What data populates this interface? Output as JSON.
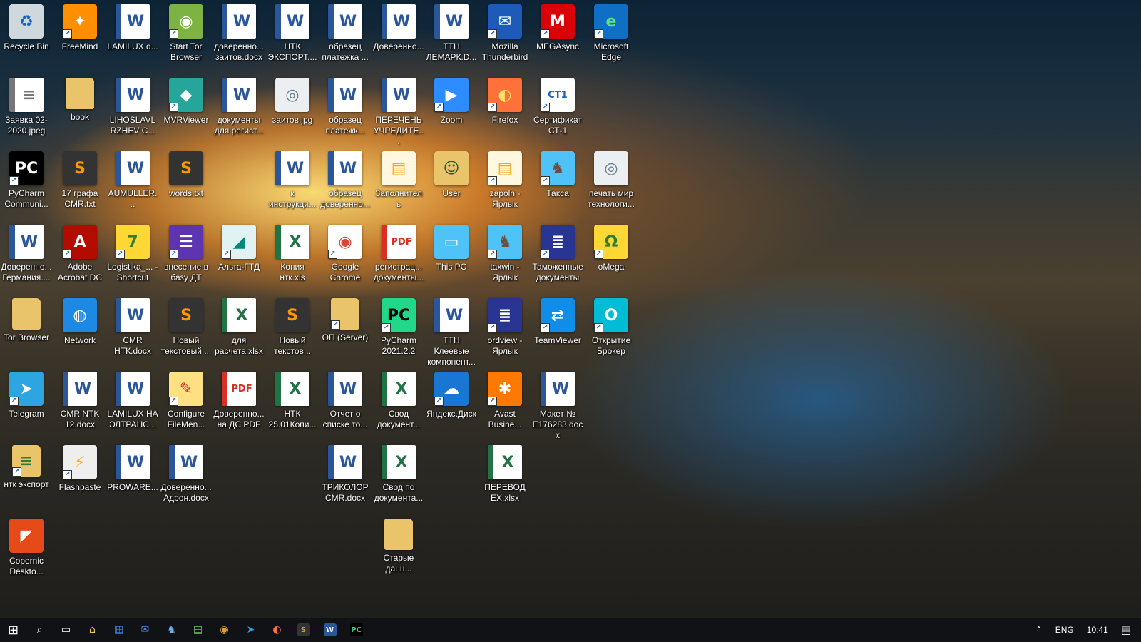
{
  "desktop": {
    "icons": [
      {
        "id": "recycle-bin",
        "label": "Recycle Bin",
        "type": "recycle",
        "col": 0,
        "row": 0,
        "shortcut": false
      },
      {
        "id": "freemind",
        "label": "FreeMind",
        "type": "butterfly",
        "col": 1,
        "row": 0,
        "shortcut": true
      },
      {
        "id": "lamilux-d",
        "label": "LAMILUX.d...",
        "type": "word",
        "col": 2,
        "row": 0,
        "shortcut": false
      },
      {
        "id": "start-tor-browser",
        "label": "Start Tor Browser",
        "type": "tor",
        "col": 3,
        "row": 0,
        "shortcut": true
      },
      {
        "id": "doverennosti-zaitov",
        "label": "доверенно... заитов.docx",
        "type": "word",
        "col": 4,
        "row": 0,
        "shortcut": false
      },
      {
        "id": "ntk-eksport",
        "label": "НТК ЭКСПОРТ....",
        "type": "word",
        "col": 5,
        "row": 0,
        "shortcut": false
      },
      {
        "id": "obrazets-platezhka",
        "label": "образец платежка ...",
        "type": "word",
        "col": 6,
        "row": 0,
        "shortcut": false
      },
      {
        "id": "doverenno-1",
        "label": "Доверенно...",
        "type": "word",
        "col": 7,
        "row": 0,
        "shortcut": false
      },
      {
        "id": "ttn-lemark",
        "label": "ТТН ЛЕМАРК.D...",
        "type": "word",
        "col": 8,
        "row": 0,
        "shortcut": false
      },
      {
        "id": "mozilla-thunderbird",
        "label": "Mozilla Thunderbird",
        "type": "thunderbird",
        "col": 9,
        "row": 0,
        "shortcut": true
      },
      {
        "id": "megasync",
        "label": "MEGAsync",
        "type": "mega",
        "col": 10,
        "row": 0,
        "shortcut": true
      },
      {
        "id": "microsoft-edge",
        "label": "Microsoft Edge",
        "type": "edge",
        "col": 11,
        "row": 0,
        "shortcut": true
      },
      {
        "id": "zayavka",
        "label": "Заявка 02-2020.jpeg",
        "type": "doc",
        "col": 0,
        "row": 1,
        "shortcut": false
      },
      {
        "id": "book",
        "label": "book",
        "type": "folder",
        "col": 1,
        "row": 1,
        "shortcut": false
      },
      {
        "id": "lihoslavl",
        "label": "LIHOSLAVL RZHEV C...",
        "type": "word",
        "col": 2,
        "row": 1,
        "shortcut": false
      },
      {
        "id": "mvrviewer",
        "label": "MVRViewer",
        "type": "mvr",
        "col": 3,
        "row": 1,
        "shortcut": true
      },
      {
        "id": "dokumenty-registr",
        "label": "документы для регист...",
        "type": "word",
        "col": 4,
        "row": 1,
        "shortcut": false
      },
      {
        "id": "zaitov-jpg",
        "label": "заитов.jpg",
        "type": "stamp",
        "col": 5,
        "row": 1,
        "shortcut": false
      },
      {
        "id": "obrazets-platezh",
        "label": "образец платежк...",
        "type": "word",
        "col": 6,
        "row": 1,
        "shortcut": false
      },
      {
        "id": "perechen",
        "label": "ПЕРЕЧЕНЬ УЧРЕДИТЕ...",
        "type": "word",
        "col": 7,
        "row": 1,
        "shortcut": false
      },
      {
        "id": "zoom",
        "label": "Zoom",
        "type": "zoom",
        "col": 8,
        "row": 1,
        "shortcut": true
      },
      {
        "id": "firefox",
        "label": "Firefox",
        "type": "firefox",
        "col": 9,
        "row": 1,
        "shortcut": true
      },
      {
        "id": "sertifikat",
        "label": "Сертификат СТ-1",
        "type": "ct1",
        "col": 10,
        "row": 1,
        "shortcut": true
      },
      {
        "id": "pycharm-community",
        "label": "PyCharm Communi...",
        "type": "pycharm",
        "col": 0,
        "row": 2,
        "shortcut": true
      },
      {
        "id": "17-grafa",
        "label": "17 графа CMR.txt",
        "type": "sublime",
        "col": 1,
        "row": 2,
        "shortcut": false
      },
      {
        "id": "aumuller",
        "label": "AUMULLER...",
        "type": "word",
        "col": 2,
        "row": 2,
        "shortcut": false
      },
      {
        "id": "words-txt",
        "label": "words.txt",
        "type": "sublime",
        "col": 3,
        "row": 2,
        "shortcut": false
      },
      {
        "id": "k-instruktsii",
        "label": "к инструкци...",
        "type": "word",
        "col": 5,
        "row": 2,
        "shortcut": false
      },
      {
        "id": "obrazets-doverennost",
        "label": "образец доверенно...",
        "type": "word",
        "col": 6,
        "row": 2,
        "shortcut": false
      },
      {
        "id": "zapolnitel",
        "label": "Заполнитель",
        "type": "zapoln",
        "col": 7,
        "row": 2,
        "shortcut": false
      },
      {
        "id": "user",
        "label": "User",
        "type": "userfolder",
        "col": 8,
        "row": 2,
        "shortcut": false
      },
      {
        "id": "zapoln-yarlyk",
        "label": "zapoln - Ярлык",
        "type": "zapoln",
        "col": 9,
        "row": 2,
        "shortcut": true
      },
      {
        "id": "taksa",
        "label": "Такса",
        "type": "dog",
        "col": 10,
        "row": 2,
        "shortcut": true
      },
      {
        "id": "pechat-mir",
        "label": "печать мир технологи...",
        "type": "stamp",
        "col": 11,
        "row": 2,
        "shortcut": false
      },
      {
        "id": "doverenno-germaniya",
        "label": "Доверенно... Германия....",
        "type": "word",
        "col": 0,
        "row": 3,
        "shortcut": false
      },
      {
        "id": "adobe-acrobat",
        "label": "Adobe Acrobat DC",
        "type": "acrobat",
        "col": 1,
        "row": 3,
        "shortcut": true
      },
      {
        "id": "logistika",
        "label": "Logistika_... - Shortcut",
        "type": "logistika",
        "col": 2,
        "row": 3,
        "shortcut": true
      },
      {
        "id": "vnesenie-v-bazu",
        "label": "внесение в базу ДТ",
        "type": "list",
        "col": 3,
        "row": 3,
        "shortcut": true
      },
      {
        "id": "alta-gtd",
        "label": "Альта-ГТД",
        "type": "alta",
        "col": 4,
        "row": 3,
        "shortcut": true
      },
      {
        "id": "kopiya-ntk",
        "label": "Копия нтк.xls",
        "type": "excel",
        "col": 5,
        "row": 3,
        "shortcut": false
      },
      {
        "id": "google-chrome",
        "label": "Google Chrome",
        "type": "chrome",
        "col": 6,
        "row": 3,
        "shortcut": true
      },
      {
        "id": "registratsiya-dokumenty",
        "label": "регистрац... документы...",
        "type": "pdf",
        "col": 7,
        "row": 3,
        "shortcut": false
      },
      {
        "id": "this-pc",
        "label": "This PC",
        "type": "pc",
        "col": 8,
        "row": 3,
        "shortcut": false
      },
      {
        "id": "taxwin",
        "label": "taxwin - Ярлык",
        "type": "dog",
        "col": 9,
        "row": 3,
        "shortcut": true
      },
      {
        "id": "tamozhennye",
        "label": "Таможенные документы",
        "type": "books",
        "col": 10,
        "row": 3,
        "shortcut": true
      },
      {
        "id": "omega",
        "label": "oMega",
        "type": "omega",
        "col": 11,
        "row": 3,
        "shortcut": true
      },
      {
        "id": "tor-browser",
        "label": "Tor Browser",
        "type": "folder",
        "col": 0,
        "row": 4,
        "shortcut": false
      },
      {
        "id": "network",
        "label": "Network",
        "type": "network",
        "col": 1,
        "row": 4,
        "shortcut": false
      },
      {
        "id": "cmr-ntk",
        "label": "CMR НТК.docx",
        "type": "word",
        "col": 2,
        "row": 4,
        "shortcut": false
      },
      {
        "id": "novyi-tekstovyi-1",
        "label": "Новый текстовый ...",
        "type": "sublime",
        "col": 3,
        "row": 4,
        "shortcut": false
      },
      {
        "id": "dlya-rascheta",
        "label": "для расчета.xlsx",
        "type": "excel",
        "col": 4,
        "row": 4,
        "shortcut": false
      },
      {
        "id": "novyi-tekstov-2",
        "label": "Новый текстов...",
        "type": "sublime",
        "col": 5,
        "row": 4,
        "shortcut": false
      },
      {
        "id": "op-server",
        "label": "ОП (Server)",
        "type": "folder",
        "col": 6,
        "row": 4,
        "shortcut": true
      },
      {
        "id": "pycharm-2021",
        "label": "PyCharm 2021.2.2",
        "type": "pycharm2",
        "col": 7,
        "row": 4,
        "shortcut": true
      },
      {
        "id": "ttn-kleevye",
        "label": "ТТН Клеевые компонент...",
        "type": "word",
        "col": 8,
        "row": 4,
        "shortcut": false
      },
      {
        "id": "ordview",
        "label": "ordview - Ярлык",
        "type": "books",
        "col": 9,
        "row": 4,
        "shortcut": true
      },
      {
        "id": "teamviewer",
        "label": "TeamViewer",
        "type": "teamviewer",
        "col": 10,
        "row": 4,
        "shortcut": true
      },
      {
        "id": "otkrytie-broker",
        "label": "Открытие Брокер",
        "type": "otkrytie",
        "col": 11,
        "row": 4,
        "shortcut": true
      },
      {
        "id": "telegram",
        "label": "Telegram",
        "type": "telegram",
        "col": 0,
        "row": 5,
        "shortcut": true
      },
      {
        "id": "cmr-ntk-12",
        "label": "CMR NTK 12.docx",
        "type": "word",
        "col": 1,
        "row": 5,
        "shortcut": false
      },
      {
        "id": "lamilux-na",
        "label": "LAMILUX НА ЭЛТРАНС...",
        "type": "word",
        "col": 2,
        "row": 5,
        "shortcut": false
      },
      {
        "id": "configure-filemen",
        "label": "Configure FileMen...",
        "type": "configure",
        "col": 3,
        "row": 5,
        "shortcut": true
      },
      {
        "id": "doverenno-ds-pdf",
        "label": "Доверенно... на ДС.PDF",
        "type": "pdf",
        "col": 4,
        "row": 5,
        "shortcut": false
      },
      {
        "id": "ntk-25-01",
        "label": "НТК 25.01Копи...",
        "type": "excel",
        "col": 5,
        "row": 5,
        "shortcut": false
      },
      {
        "id": "otchet-o-spiske",
        "label": "Отчет о списке то...",
        "type": "word",
        "col": 6,
        "row": 5,
        "shortcut": false
      },
      {
        "id": "svod-dokument",
        "label": "Свод документ...",
        "type": "excel",
        "col": 7,
        "row": 5,
        "shortcut": false
      },
      {
        "id": "yandex-disk",
        "label": "Яндекс.Диск",
        "type": "yandex",
        "col": 8,
        "row": 5,
        "shortcut": true
      },
      {
        "id": "avast",
        "label": "Avast Busine...",
        "type": "avast",
        "col": 9,
        "row": 5,
        "shortcut": true
      },
      {
        "id": "maket",
        "label": "Макет № E176283.docx",
        "type": "word",
        "col": 10,
        "row": 5,
        "shortcut": false
      },
      {
        "id": "ntk-eksport-2",
        "label": "нтк экспорт",
        "type": "folder2",
        "col": 0,
        "row": 6,
        "shortcut": true
      },
      {
        "id": "flashpaste",
        "label": "Flashpaste",
        "type": "flashpaste",
        "col": 1,
        "row": 6,
        "shortcut": true
      },
      {
        "id": "proware",
        "label": "PROWARE...",
        "type": "word",
        "col": 2,
        "row": 6,
        "shortcut": false
      },
      {
        "id": "doverenno-adron",
        "label": "Доверенно... Адрон.docx",
        "type": "word",
        "col": 3,
        "row": 6,
        "shortcut": false
      },
      {
        "id": "trikolor",
        "label": "ТРИКОЛОР CMR.docx",
        "type": "word",
        "col": 6,
        "row": 6,
        "shortcut": false
      },
      {
        "id": "svod-po-dokumenta",
        "label": "Свод по документа...",
        "type": "excel",
        "col": 7,
        "row": 6,
        "shortcut": false
      },
      {
        "id": "perevod-ex",
        "label": "ПЕРЕВОД EX.xlsx",
        "type": "excel",
        "col": 9,
        "row": 6,
        "shortcut": false
      },
      {
        "id": "copernic",
        "label": "Copernic Deskto...",
        "type": "copernic",
        "col": 0,
        "row": 7,
        "shortcut": false
      },
      {
        "id": "starye-dann",
        "label": "Старые данн...",
        "type": "folder",
        "col": 7,
        "row": 7,
        "shortcut": false
      }
    ]
  },
  "icon_styles": {
    "word": {
      "bg": "#ffffff",
      "fg": "#2b579a",
      "text": "W"
    },
    "excel": {
      "bg": "#ffffff",
      "fg": "#217346",
      "text": "X"
    },
    "pdf": {
      "bg": "#ffffff",
      "fg": "#d93025",
      "text": "PDF"
    },
    "folder": {
      "bg": "#e9c46a",
      "fg": "#7a5a10",
      "text": ""
    },
    "folder2": {
      "bg": "#e9c46a",
      "fg": "#2e7d32",
      "text": "≡"
    },
    "userfolder": {
      "bg": "#e9c46a",
      "fg": "#1b5e20",
      "text": "☺"
    },
    "recycle": {
      "bg": "#cfd8dc",
      "fg": "#1565c0",
      "text": "♻"
    },
    "butterfly": {
      "bg": "#ff8f00",
      "fg": "#ffffff",
      "text": "✦"
    },
    "tor": {
      "bg": "#7cb342",
      "fg": "#ffffff",
      "text": "◉"
    },
    "thunderbird": {
      "bg": "#1e5bb8",
      "fg": "#ffffff",
      "text": "✉"
    },
    "mega": {
      "bg": "#d90007",
      "fg": "#ffffff",
      "text": "M"
    },
    "edge": {
      "bg": "#0f6fc5",
      "fg": "#5ee07a",
      "text": "e"
    },
    "doc": {
      "bg": "#ffffff",
      "fg": "#777777",
      "text": "≡"
    },
    "mvr": {
      "bg": "#26a69a",
      "fg": "#ffffff",
      "text": "◆"
    },
    "stamp": {
      "bg": "#eceff1",
      "fg": "#607d8b",
      "text": "◎"
    },
    "zoom": {
      "bg": "#2d8cff",
      "fg": "#ffffff",
      "text": "▶"
    },
    "firefox": {
      "bg": "#ff7139",
      "fg": "#ffe066",
      "text": "◐"
    },
    "ct1": {
      "bg": "#ffffff",
      "fg": "#1565c0",
      "text": "CT1"
    },
    "pycharm": {
      "bg": "#000000",
      "fg": "#ffffff",
      "text": "PC"
    },
    "pycharm2": {
      "bg": "#21d789",
      "fg": "#000000",
      "text": "PC"
    },
    "sublime": {
      "bg": "#333333",
      "fg": "#ff9800",
      "text": "S"
    },
    "zapoln": {
      "bg": "#fff8e1",
      "fg": "#f9a825",
      "text": "▤"
    },
    "dog": {
      "bg": "#4fc3f7",
      "fg": "#6d4c41",
      "text": "♞"
    },
    "acrobat": {
      "bg": "#b30b00",
      "fg": "#ffffff",
      "text": "A"
    },
    "logistika": {
      "bg": "#fdd835",
      "fg": "#2e7d32",
      "text": "7"
    },
    "list": {
      "bg": "#5e35b1",
      "fg": "#ffffff",
      "text": "☰"
    },
    "alta": {
      "bg": "#e0f2f1",
      "fg": "#00897b",
      "text": "◢"
    },
    "chrome": {
      "bg": "#ffffff",
      "fg": "#db4437",
      "text": "◉"
    },
    "pc": {
      "bg": "#4fc3f7",
      "fg": "#ffffff",
      "text": "▭"
    },
    "books": {
      "bg": "#283593",
      "fg": "#ffffff",
      "text": "≣"
    },
    "omega": {
      "bg": "#fdd835",
      "fg": "#2e7d32",
      "text": "Ω"
    },
    "network": {
      "bg": "#1e88e5",
      "fg": "#ffffff",
      "text": "◍"
    },
    "teamviewer": {
      "bg": "#0e8ee9",
      "fg": "#ffffff",
      "text": "⇄"
    },
    "otkrytie": {
      "bg": "#00bcd4",
      "fg": "#ffffff",
      "text": "O"
    },
    "telegram": {
      "bg": "#2ca5e0",
      "fg": "#ffffff",
      "text": "➤"
    },
    "configure": {
      "bg": "#ffe082",
      "fg": "#c62828",
      "text": "✎"
    },
    "yandex": {
      "bg": "#1976d2",
      "fg": "#ffffff",
      "text": "☁"
    },
    "avast": {
      "bg": "#ff7800",
      "fg": "#ffffff",
      "text": "✱"
    },
    "flashpaste": {
      "bg": "#eeeeee",
      "fg": "#ffb300",
      "text": "⚡"
    },
    "copernic": {
      "bg": "#e64a19",
      "fg": "#ffffff",
      "text": "◤"
    }
  },
  "taskbar": {
    "items": [
      {
        "id": "start",
        "glyph": "⊞",
        "color": "#ffffff"
      },
      {
        "id": "search",
        "glyph": "⌕",
        "color": "#ffffff"
      },
      {
        "id": "task-view",
        "glyph": "▭",
        "color": "#ffffff"
      },
      {
        "id": "home",
        "glyph": "⌂",
        "color": "#f2c744"
      },
      {
        "id": "app-blue",
        "glyph": "▦",
        "color": "#3d7bd9"
      },
      {
        "id": "thunderbird",
        "glyph": "✉",
        "color": "#4d8fe0"
      },
      {
        "id": "app-dog",
        "glyph": "♞",
        "color": "#6db3e8"
      },
      {
        "id": "app-screen",
        "glyph": "▤",
        "color": "#6dbf67"
      },
      {
        "id": "chrome",
        "glyph": "◉",
        "color": "#e0a030"
      },
      {
        "id": "telegram",
        "glyph": "➤",
        "color": "#2ca5e0"
      },
      {
        "id": "firefox",
        "glyph": "◐",
        "color": "#ff7139"
      },
      {
        "id": "sublime",
        "glyph": "S",
        "color": "#ff9800"
      },
      {
        "id": "word",
        "glyph": "W",
        "color": "#2b579a"
      },
      {
        "id": "pycharm",
        "glyph": "PC",
        "color": "#21d789"
      }
    ],
    "tray": {
      "chevron": "⌃",
      "language": "ENG",
      "time": "10:41",
      "notification": "▤"
    }
  }
}
